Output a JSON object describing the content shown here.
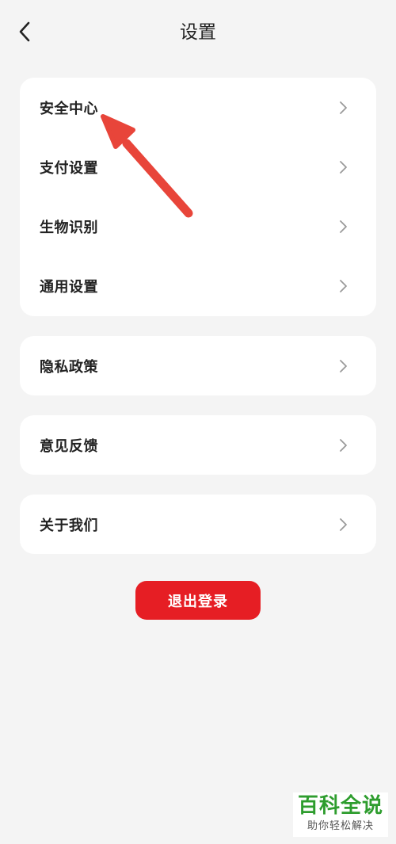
{
  "header": {
    "title": "设置",
    "back_icon": "chevron-left-icon"
  },
  "groups": [
    {
      "items": [
        {
          "label": "安全中心"
        },
        {
          "label": "支付设置"
        },
        {
          "label": "生物识别"
        },
        {
          "label": "通用设置"
        }
      ]
    },
    {
      "items": [
        {
          "label": "隐私政策"
        }
      ]
    },
    {
      "items": [
        {
          "label": "意见反馈"
        }
      ]
    },
    {
      "items": [
        {
          "label": "关于我们"
        }
      ]
    }
  ],
  "logout": {
    "label": "退出登录"
  },
  "colors": {
    "background": "#f4f4f4",
    "card": "#ffffff",
    "logout_button": "#e61e24",
    "annotation_arrow": "#e8453a",
    "watermark_text": "#2e9d2e"
  },
  "watermark": {
    "title": "百科全说",
    "subtitle": "助你轻松解决"
  }
}
